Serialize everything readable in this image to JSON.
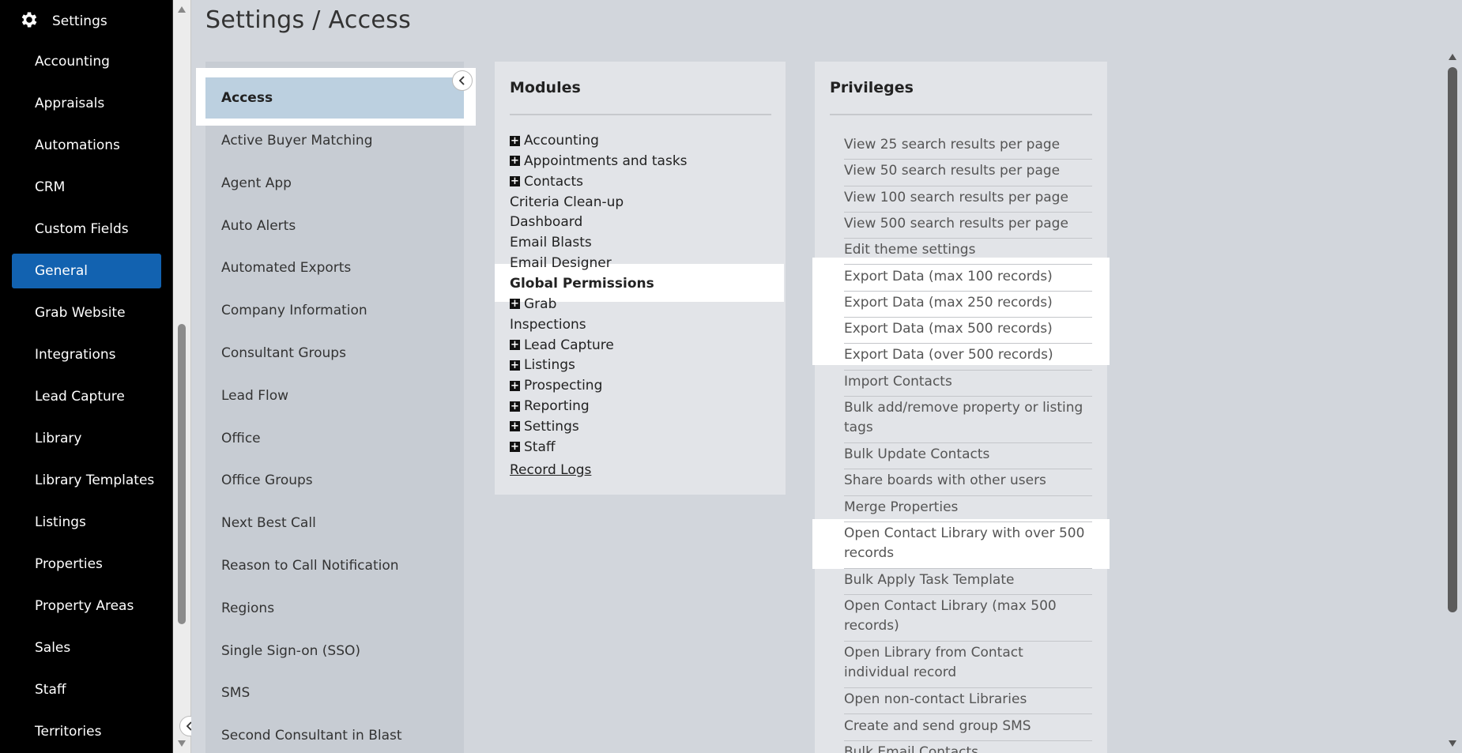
{
  "nav": {
    "title": "Settings",
    "items": [
      {
        "label": "Accounting"
      },
      {
        "label": "Appraisals"
      },
      {
        "label": "Automations"
      },
      {
        "label": "CRM"
      },
      {
        "label": "Custom Fields"
      },
      {
        "label": "General"
      },
      {
        "label": "Grab Website"
      },
      {
        "label": "Integrations"
      },
      {
        "label": "Lead Capture"
      },
      {
        "label": "Library"
      },
      {
        "label": "Library Templates"
      },
      {
        "label": "Listings"
      },
      {
        "label": "Properties"
      },
      {
        "label": "Property Areas"
      },
      {
        "label": "Sales"
      },
      {
        "label": "Staff"
      },
      {
        "label": "Territories"
      }
    ],
    "active": "General"
  },
  "header": {
    "title": "Settings / Access"
  },
  "categories": {
    "selected": "Access",
    "items": [
      {
        "label": "Active Buyer Matching"
      },
      {
        "label": "Agent App"
      },
      {
        "label": "Auto Alerts"
      },
      {
        "label": "Automated Exports"
      },
      {
        "label": "Company Information"
      },
      {
        "label": "Consultant Groups"
      },
      {
        "label": "Lead Flow"
      },
      {
        "label": "Office"
      },
      {
        "label": "Office Groups"
      },
      {
        "label": "Next Best Call"
      },
      {
        "label": "Reason to Call Notification"
      },
      {
        "label": "Regions"
      },
      {
        "label": "Single Sign-on (SSO)"
      },
      {
        "label": "SMS"
      },
      {
        "label": "Second Consultant in Blast"
      }
    ]
  },
  "modules": {
    "title": "Modules",
    "items": [
      {
        "label": "Accounting",
        "expandable": true
      },
      {
        "label": "Appointments and tasks",
        "expandable": true
      },
      {
        "label": "Contacts",
        "expandable": true
      },
      {
        "label": "Criteria Clean-up",
        "expandable": false
      },
      {
        "label": "Dashboard",
        "expandable": false
      },
      {
        "label": "Email Blasts",
        "expandable": false
      },
      {
        "label": "Email Designer",
        "expandable": false
      },
      {
        "label": "Global Permissions",
        "expandable": false,
        "selected": true
      },
      {
        "label": "Grab",
        "expandable": true
      },
      {
        "label": "Inspections",
        "expandable": false
      },
      {
        "label": "Lead Capture",
        "expandable": true
      },
      {
        "label": "Listings",
        "expandable": true
      },
      {
        "label": "Prospecting",
        "expandable": true
      },
      {
        "label": "Reporting",
        "expandable": true
      },
      {
        "label": "Settings",
        "expandable": true
      },
      {
        "label": "Staff",
        "expandable": true
      },
      {
        "label": "Record Logs",
        "expandable": false,
        "link": true
      }
    ]
  },
  "privileges": {
    "title": "Privileges",
    "items": [
      {
        "label": "View 25 search results per page"
      },
      {
        "label": "View 50 search results per page"
      },
      {
        "label": "View 100 search results per page"
      },
      {
        "label": "View 500 search results per page"
      },
      {
        "label": "Edit theme settings"
      },
      {
        "label": "Export Data (max 100 records)"
      },
      {
        "label": "Export Data (max 250 records)"
      },
      {
        "label": "Export Data (max 500 records)"
      },
      {
        "label": "Export Data (over 500 records)"
      },
      {
        "label": "Import Contacts"
      },
      {
        "label": "Bulk add/remove property or listing tags"
      },
      {
        "label": "Bulk Update Contacts"
      },
      {
        "label": "Share boards with other users"
      },
      {
        "label": "Merge Properties"
      },
      {
        "label": "Open Contact Library with over 500 records"
      },
      {
        "label": "Bulk Apply Task Template"
      },
      {
        "label": "Open Contact Library (max 500 records)"
      },
      {
        "label": "Open Library from Contact individual record"
      },
      {
        "label": "Open non-contact Libraries"
      },
      {
        "label": "Create and send group SMS"
      },
      {
        "label": "Bulk Email Contacts"
      }
    ]
  },
  "colors": {
    "nav_bg": "#000000",
    "nav_active": "#1262b0",
    "content_bg": "#d2d6dc",
    "selected_category": "#bcd0e0",
    "panel_bg": "#e2e4e8"
  }
}
